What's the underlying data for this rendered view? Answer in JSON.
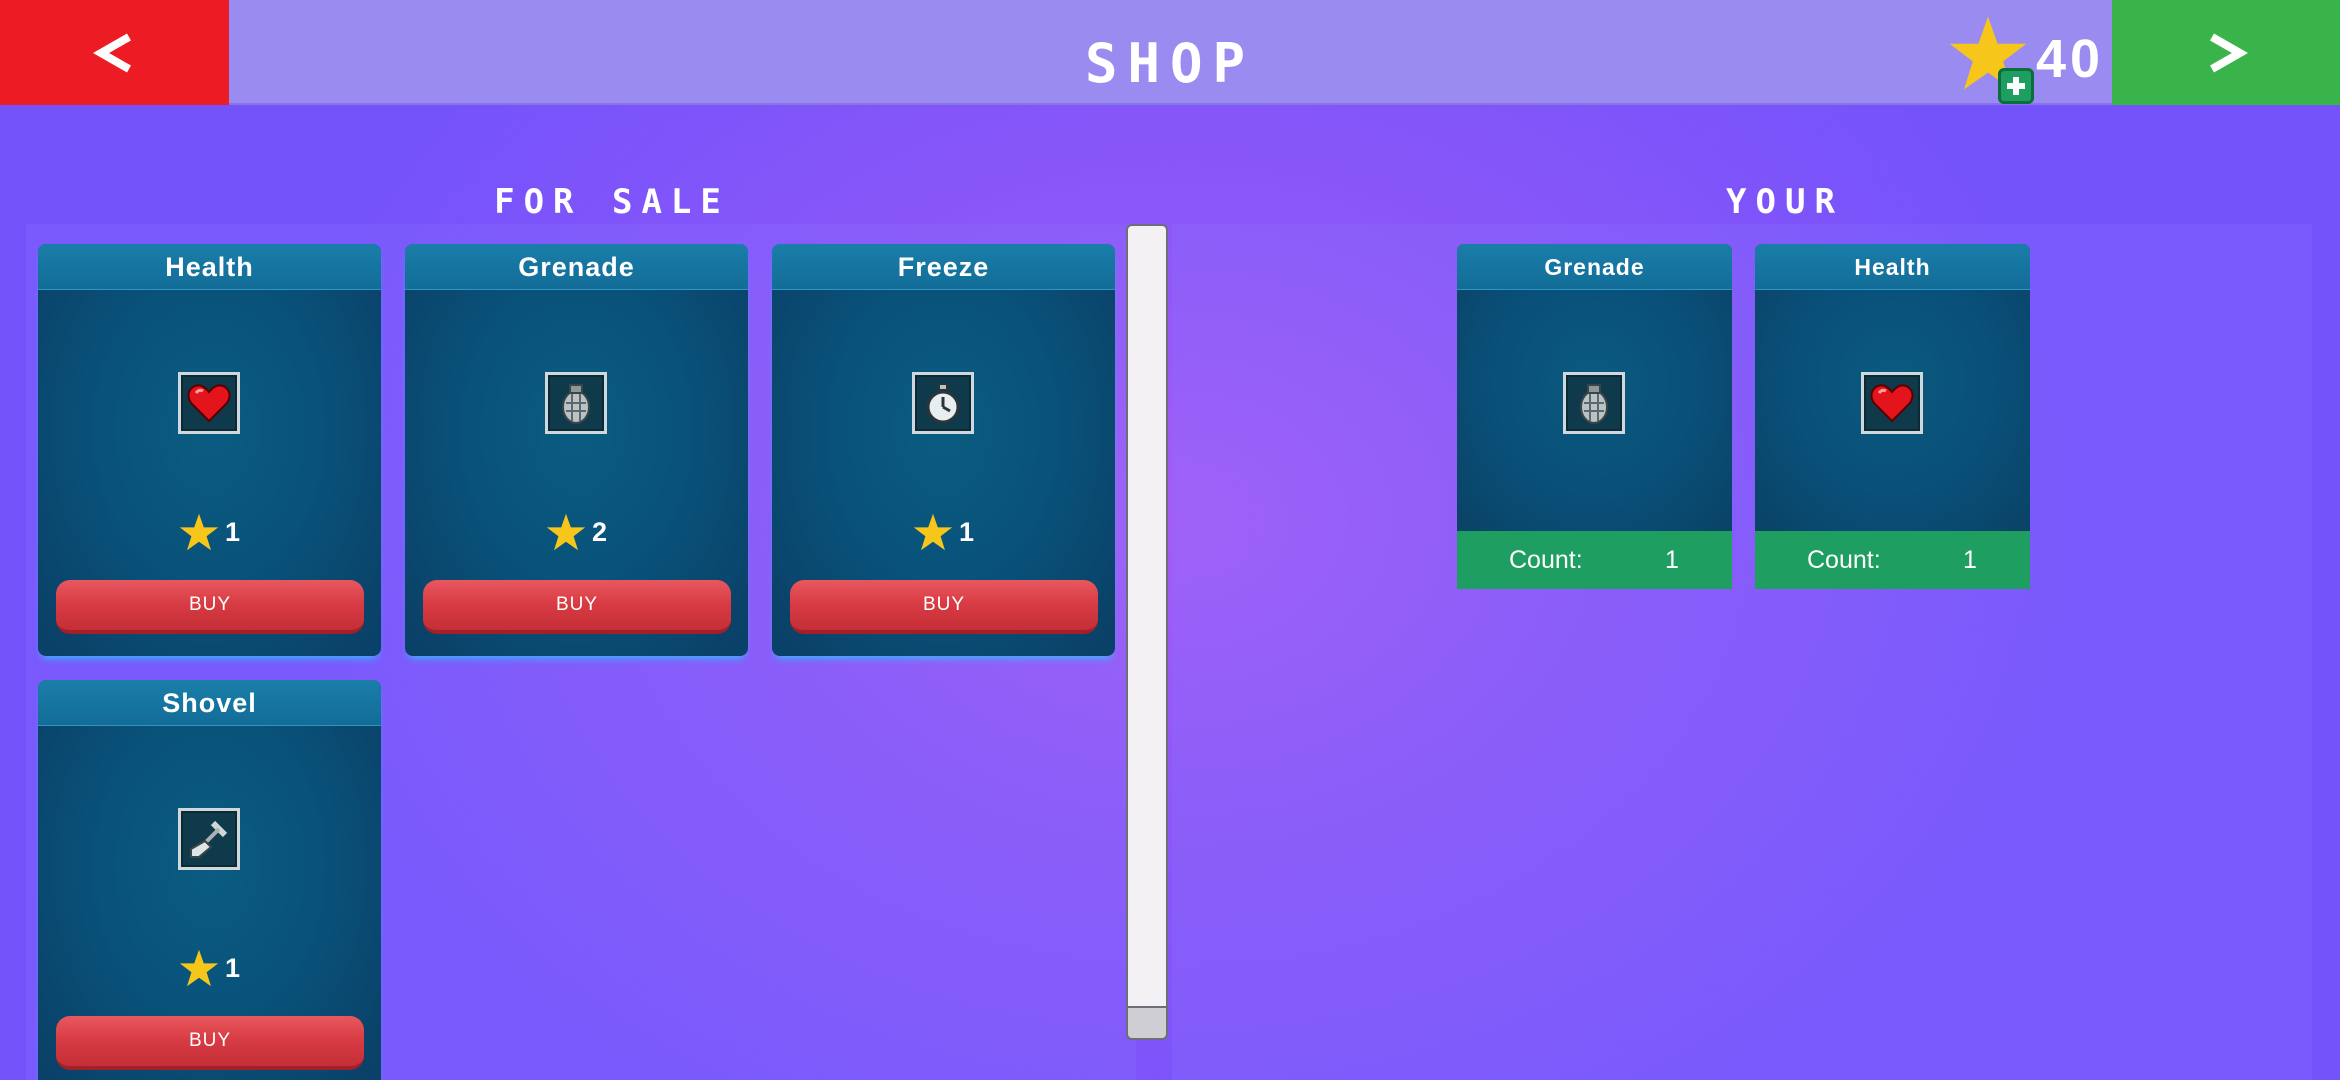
{
  "header": {
    "title": "SHOP",
    "back_label": "<",
    "next_label": ">",
    "coins": "40"
  },
  "sections": {
    "for_sale": "FOR SALE",
    "yours": "YOUR"
  },
  "for_sale_items": [
    {
      "name": "Health",
      "icon": "heart-icon",
      "price": "1",
      "button": "BUY"
    },
    {
      "name": "Grenade",
      "icon": "grenade-icon",
      "price": "2",
      "button": "BUY"
    },
    {
      "name": "Freeze",
      "icon": "stopwatch-icon",
      "price": "1",
      "button": "BUY"
    },
    {
      "name": "Shovel",
      "icon": "shovel-icon",
      "price": "1",
      "button": "BUY"
    }
  ],
  "owned_items": [
    {
      "name": "Grenade",
      "icon": "grenade-icon",
      "count_label": "Count:",
      "count": "1"
    },
    {
      "name": "Health",
      "icon": "heart-icon",
      "count_label": "Count:",
      "count": "1"
    }
  ],
  "colors": {
    "back": "#ed1c24",
    "next": "#39b44a",
    "topbar": "#9a8bf0",
    "buy": "#d73a42",
    "count_bar": "#1f9e62",
    "star": "#f7c61a"
  }
}
